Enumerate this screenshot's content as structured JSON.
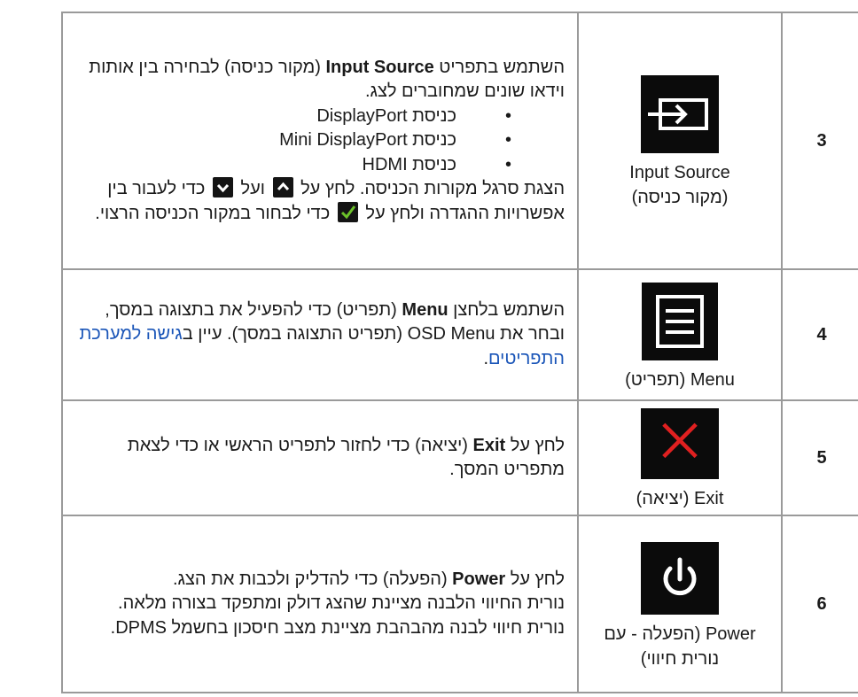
{
  "rows": [
    {
      "number": "3",
      "icon_name": "input-source-icon",
      "label_en": "Input Source",
      "label_he": "(מקור כניסה)",
      "intro_pre": "השתמש בתפריט ",
      "intro_bold": "Input Source",
      "intro_post": " (מקור כניסה) לבחירה בין אותות וידאו שונים שמחוברים לצג.",
      "ports": [
        "כניסת DisplayPort",
        "כניסת Mini DisplayPort",
        "כניסת HDMI"
      ],
      "bullet_char": "•",
      "nav_pre": "הצגת סרגל מקורות הכניסה. לחץ על ",
      "nav_and": " ועל ",
      "nav_mid": " כדי לעבור בין אפשרויות ההגדרה ולחץ על ",
      "nav_post": " כדי לבחור במקור הכניסה הרצוי."
    },
    {
      "number": "4",
      "icon_name": "menu-icon",
      "label": "Menu (תפריט)",
      "text_pre": "השתמש בלחצן ",
      "text_bold": "Menu",
      "text_post": " (תפריט) כדי להפעיל את בתצוגה במסך, ובחר את OSD Menu (תפריט התצוגה במסך). עיין ב",
      "link_text": "גישה למערכת התפריטים",
      "text_end": "."
    },
    {
      "number": "5",
      "icon_name": "exit-icon",
      "label": "Exit (יציאה)",
      "text_pre": "לחץ על ",
      "text_bold": "Exit",
      "text_post": " (יציאה) כדי לחזור לתפריט הראשי או כדי לצאת מתפריט המסך."
    },
    {
      "number": "6",
      "icon_name": "power-icon",
      "label_line1": "Power (הפעלה - עם",
      "label_line2": "נורית חיווי)",
      "text_pre": "לחץ על ",
      "text_bold": "Power",
      "text_post": " (הפעלה) כדי להדליק ולכבות את הצג.",
      "line2": "נורית החיווי הלבנה מציינת שהצג דולק ומתפקד בצורה מלאה.",
      "line3": "נורית חיווי לבנה מהבהבת מציינת מצב חיסכון בחשמל DPMS."
    }
  ],
  "colors": {
    "border": "#9a9a9a",
    "icon_bg": "#0b0b0b",
    "link": "#1a55b8",
    "exit_x": "#e02020",
    "check": "#6cc22a"
  }
}
